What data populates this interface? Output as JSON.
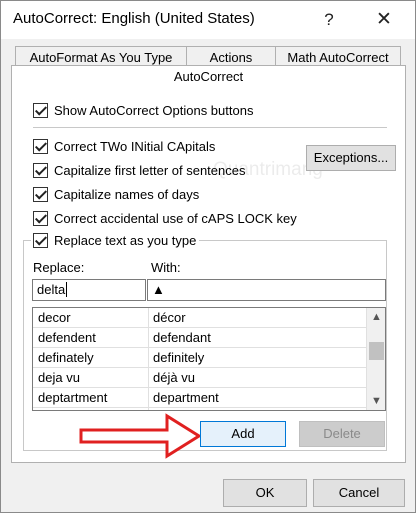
{
  "window": {
    "title": "AutoCorrect: English (United States)",
    "help_glyph": "?",
    "close_glyph": "✕"
  },
  "tabs": [
    {
      "label": "AutoFormat As You Type"
    },
    {
      "label": "Actions"
    },
    {
      "label": "Math AutoCorrect"
    },
    {
      "label": "AutoCorrect"
    }
  ],
  "options": {
    "show_buttons": "Show AutoCorrect Options buttons",
    "two_initials": "Correct TWo INitial CApitals",
    "first_letter": "Capitalize first letter of sentences",
    "names_of_days": "Capitalize names of days",
    "caps_lock": "Correct accidental use of cAPS LOCK key",
    "replace_text": "Replace text as you type"
  },
  "buttons": {
    "exceptions": "Exceptions...",
    "add": "Add",
    "delete": "Delete",
    "ok": "OK",
    "cancel": "Cancel"
  },
  "replace": {
    "replace_label": "Replace:",
    "with_label": "With:",
    "replace_value": "delta",
    "with_value": "▲"
  },
  "entries": [
    {
      "replace": "decor",
      "with": "décor"
    },
    {
      "replace": "defendent",
      "with": "defendant"
    },
    {
      "replace": "definately",
      "with": "definitely"
    },
    {
      "replace": "deja vu",
      "with": "déjà vu"
    },
    {
      "replace": "deptartment",
      "with": "department"
    }
  ],
  "scroll": {
    "up": "▲",
    "down": "▼"
  },
  "watermark": "Quantrimang",
  "colors": {
    "arrow": "#e02020",
    "accent": "#0078d7"
  }
}
